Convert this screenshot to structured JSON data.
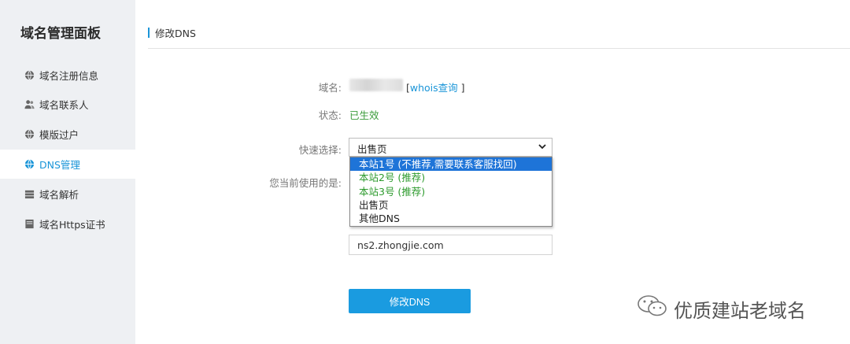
{
  "sidebar": {
    "title": "域名管理面板",
    "items": [
      {
        "label": "域名注册信息",
        "icon": "globe-icon"
      },
      {
        "label": "域名联系人",
        "icon": "users-icon"
      },
      {
        "label": "模版过户",
        "icon": "globe-icon"
      },
      {
        "label": "DNS管理",
        "icon": "globe-icon",
        "active": true
      },
      {
        "label": "域名解析",
        "icon": "server-icon"
      },
      {
        "label": "域名Https证书",
        "icon": "certificate-icon"
      }
    ]
  },
  "header": {
    "title": "修改DNS"
  },
  "form": {
    "domain_label": "域名:",
    "whois_open": "[",
    "whois_link": "whois查询",
    "whois_close": "]",
    "status_label": "状态:",
    "status_value": "已生效",
    "quick_select_label": "快速选择:",
    "quick_select_value": "出售页",
    "current_label": "您当前使用的是:",
    "options": [
      "本站1号 (不推荐,需要联系客服找回)",
      "本站2号 (推荐)",
      "本站3号 (推荐)",
      "出售页",
      "其他DNS"
    ],
    "ns2_value": "ns2.zhongjie.com",
    "submit_label": "修改DNS"
  },
  "watermark": {
    "text": "优质建站老域名"
  },
  "colors": {
    "accent": "#1a95d8",
    "status_green": "#3a9b3a",
    "selected_option": "#1e74d8",
    "sidebar_bg": "#eef0f3"
  }
}
